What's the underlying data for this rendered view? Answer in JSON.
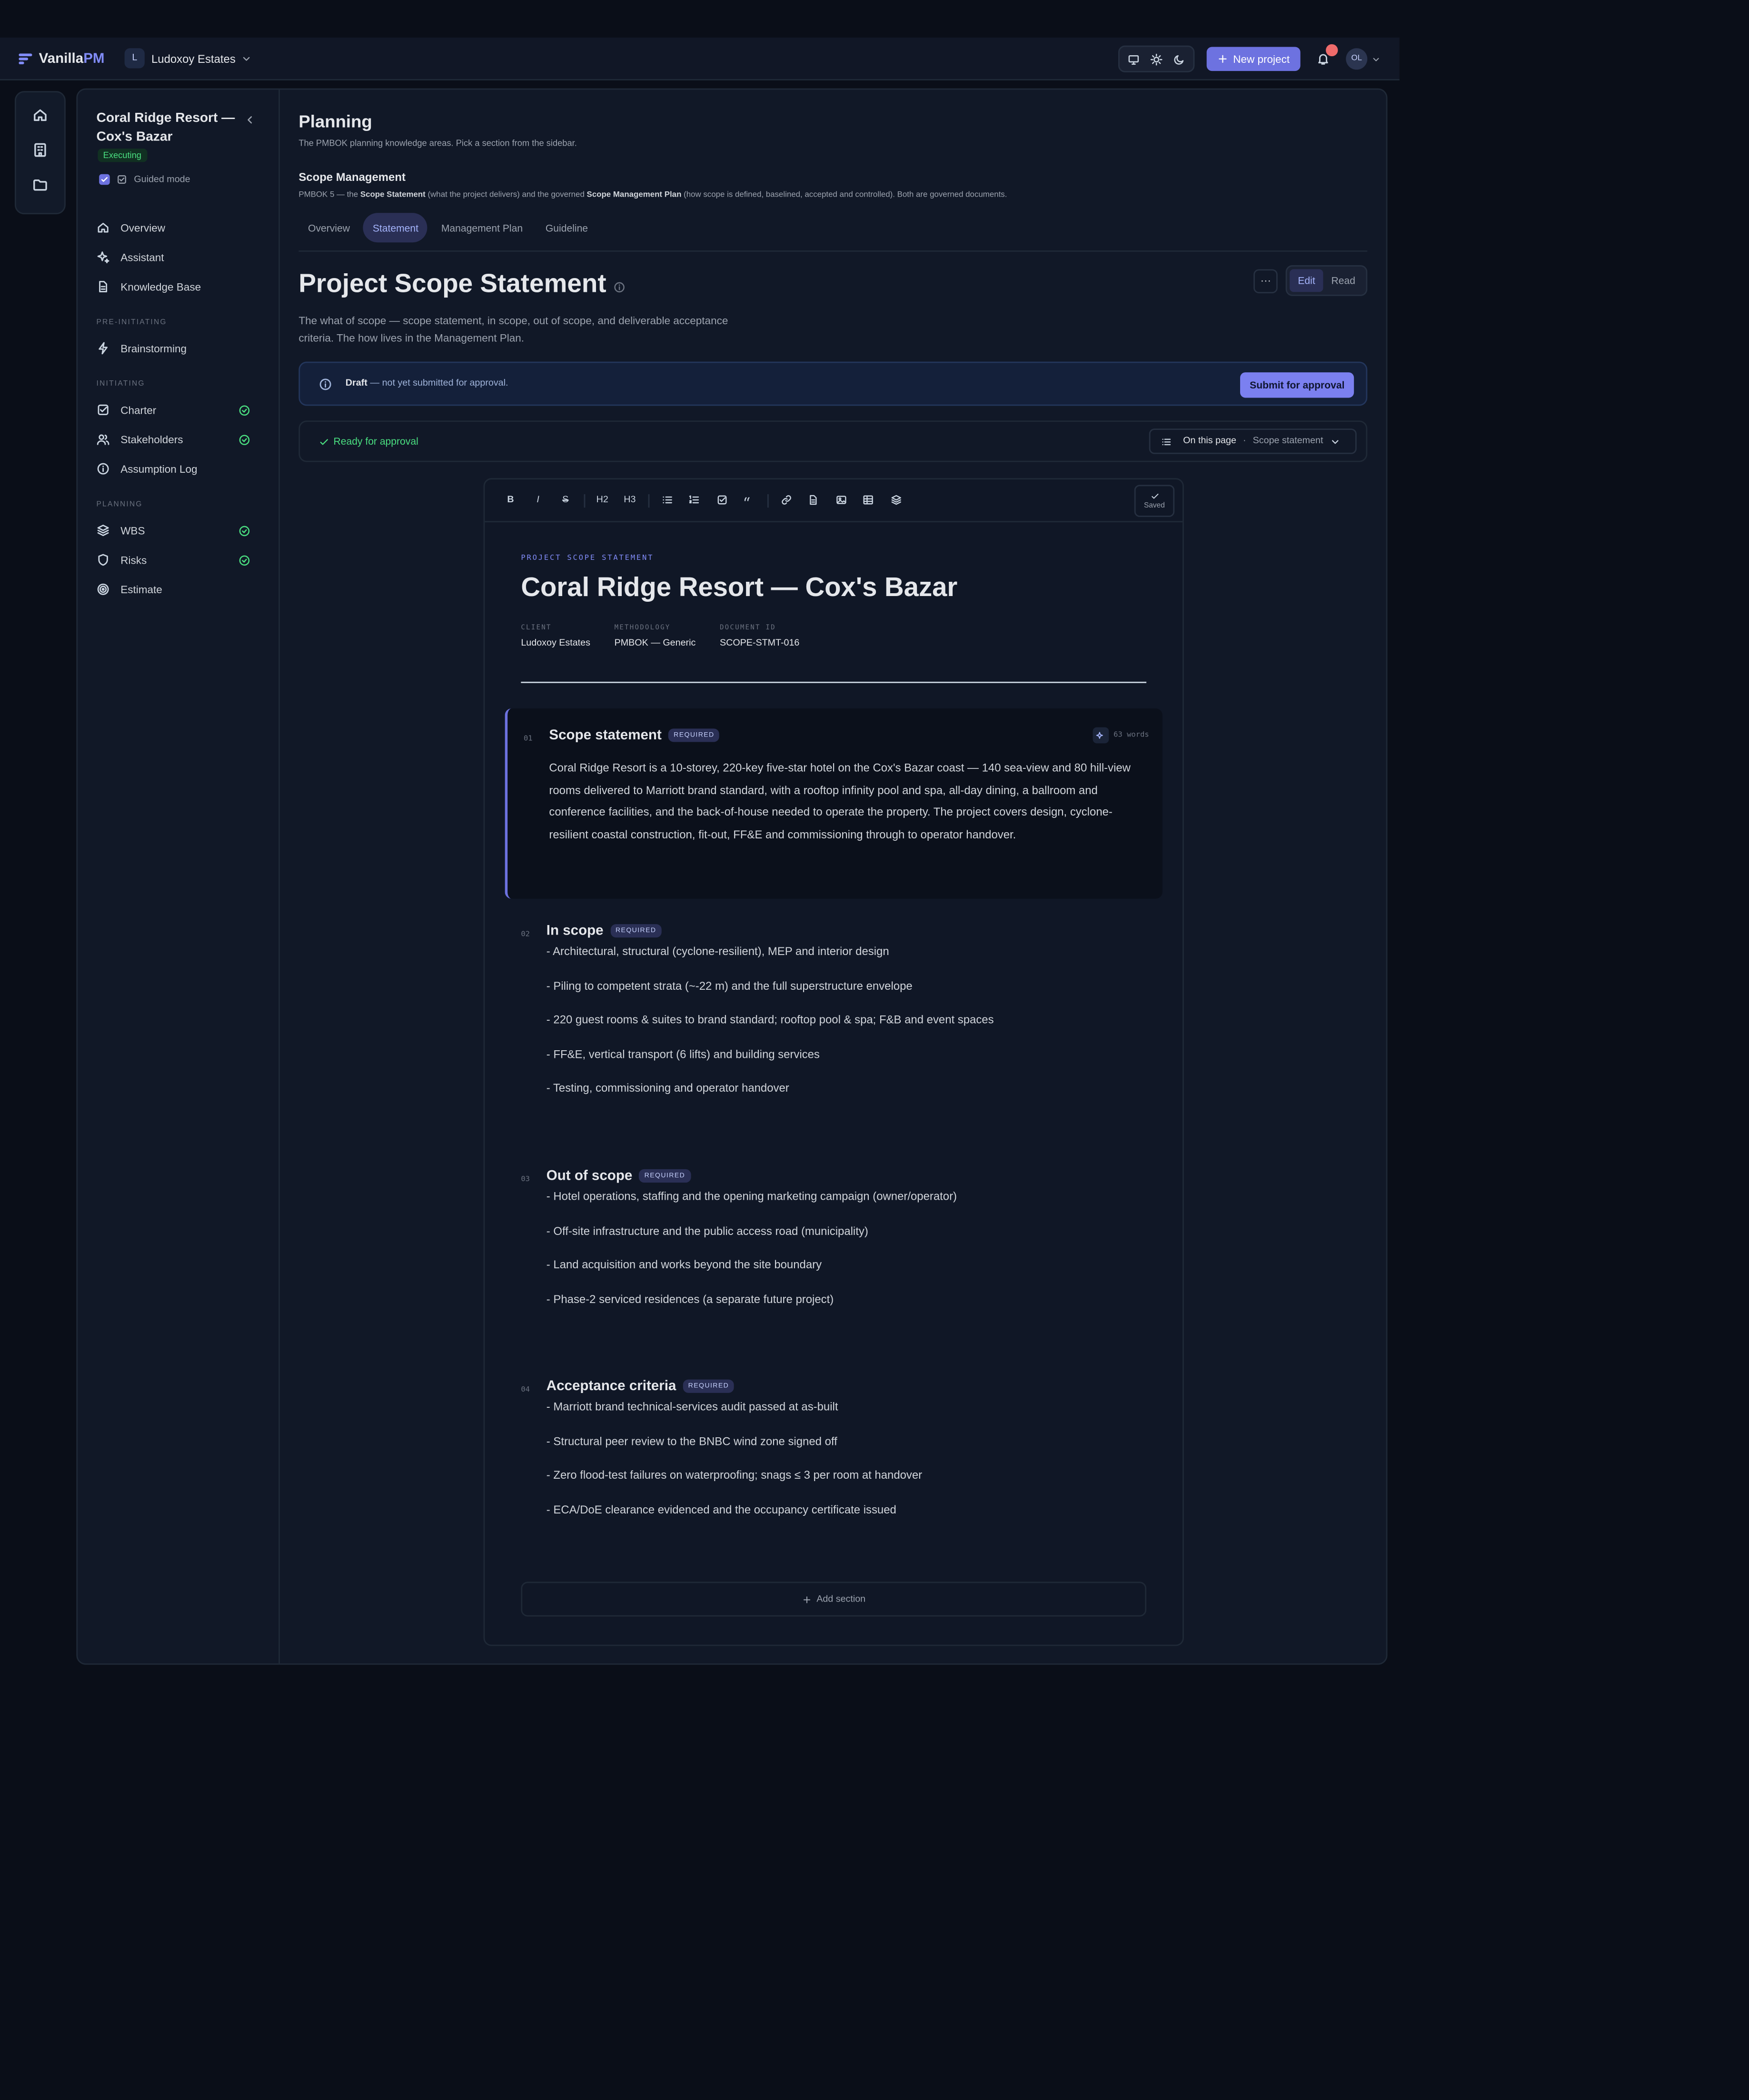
{
  "topbar": {
    "brand_vanilla": "Vanilla",
    "brand_pm": "PM",
    "workspace_initial": "L",
    "workspace_name": "Ludoxoy Estates",
    "new_project": "New project",
    "notifications_count": "",
    "avatar_initials": "OL"
  },
  "sidebar": {
    "project_title": "Coral Ridge Resort — Cox's Bazar",
    "status": "Executing",
    "guided_mode": "Guided mode",
    "overview": "Overview",
    "assistant": "Assistant",
    "knowledge_base": "Knowledge Base",
    "group_pre": "PRE-INITIATING",
    "brainstorming": "Brainstorming",
    "group_init": "INITIATING",
    "charter": "Charter",
    "stakeholders": "Stakeholders",
    "assumption_log": "Assumption Log",
    "group_plan": "PLANNING",
    "wbs": "WBS",
    "risks": "Risks",
    "estimate": "Estimate"
  },
  "main": {
    "title": "Planning",
    "subtitle": "The PMBOK planning knowledge areas. Pick a section from the sidebar.",
    "area_title": "Scope Management",
    "area_desc_1": "PMBOK 5 — the ",
    "area_desc_b1": "Scope Statement",
    "area_desc_2": " (what the project delivers) and the governed ",
    "area_desc_b2": "Scope Management Plan",
    "area_desc_3": " (how scope is defined, baselined, accepted and controlled). Both are governed documents.",
    "tabs": [
      "Overview",
      "Statement",
      "Management Plan",
      "Guideline"
    ],
    "active_tab": "Statement",
    "doc_title": "Project Scope Statement",
    "doc_desc": "The what of scope — scope statement, in scope, out of scope, and deliverable acceptance criteria. The how lives in the Management Plan.",
    "menu": "···",
    "edit": "Edit",
    "read": "Read",
    "draft_label": "Draft",
    "draft_text": "— not yet submitted for approval.",
    "submit": "Submit for approval",
    "ready": "Ready for approval",
    "on_this_page": "On this page",
    "on_this_page_sep": "·",
    "on_this_page_current": "Scope statement"
  },
  "editor": {
    "toolbar": {
      "bold": "B",
      "italic": "I",
      "strike": "S",
      "h2": "H2",
      "h3": "H3"
    },
    "saved": "Saved",
    "eyebrow": "PROJECT SCOPE STATEMENT",
    "heading": "Coral Ridge Resort — Cox's Bazar",
    "meta": [
      {
        "key": "CLIENT",
        "value": "Ludoxoy Estates"
      },
      {
        "key": "METHODOLOGY",
        "value": "PMBOK — Generic"
      },
      {
        "key": "DOCUMENT ID",
        "value": "SCOPE-STMT-016"
      }
    ],
    "required": "REQUIRED",
    "sections": [
      {
        "num": "01",
        "title": "Scope statement",
        "word_count": "63 words",
        "body": "Coral Ridge Resort is a 10-storey, 220-key five-star hotel on the Cox's Bazar coast — 140 sea-view and 80 hill-view rooms delivered to Marriott brand standard, with a rooftop infinity pool and spa, all-day dining, a ballroom and conference facilities, and the back-of-house needed to operate the property. The project covers design, cyclone-resilient coastal construction, fit-out, FF&E and commissioning through to operator handover."
      },
      {
        "num": "02",
        "title": "In scope",
        "items": [
          "- Architectural, structural (cyclone-resilient), MEP and interior design",
          "- Piling to competent strata (~-22 m) and the full superstructure envelope",
          "- 220 guest rooms & suites to brand standard; rooftop pool & spa; F&B and event spaces",
          "- FF&E, vertical transport (6 lifts) and building services",
          "- Testing, commissioning and operator handover"
        ]
      },
      {
        "num": "03",
        "title": "Out of scope",
        "items": [
          "- Hotel operations, staffing and the opening marketing campaign (owner/operator)",
          "- Off-site infrastructure and the public access road (municipality)",
          "- Land acquisition and works beyond the site boundary",
          "- Phase-2 serviced residences (a separate future project)"
        ]
      },
      {
        "num": "04",
        "title": "Acceptance criteria",
        "items": [
          "- Marriott brand technical-services audit passed at as-built",
          "- Structural peer review to the BNBC wind zone signed off",
          "- Zero flood-test failures on waterproofing; snags ≤ 3 per room at handover",
          "- ECA/DoE clearance evidenced and the occupancy certificate issued"
        ]
      }
    ],
    "add_section": "Add section"
  }
}
